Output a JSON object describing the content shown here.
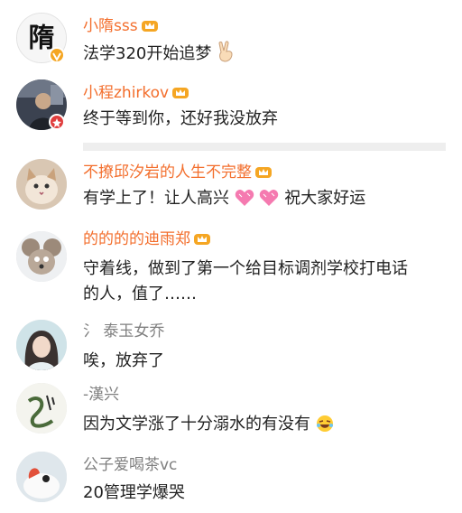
{
  "comments": [
    {
      "username": "小隋sss",
      "text": "法学320开始追梦",
      "text_icon": "victory-hand-icon",
      "name_style": "orange",
      "avatar_glyph": "隋"
    },
    {
      "username": "小程zhirkov",
      "text": "终于等到你，还好我没放弃",
      "name_style": "orange"
    },
    {
      "username": "不撩邱汐岩的人生不完整",
      "text_part1": "有学上了！让人高兴",
      "text_part2": "祝大家好运",
      "name_style": "orange"
    },
    {
      "username": "的的的的迪雨郑",
      "text": "守着线，做到了第一个给目标调剂学校打电话的人，值了……",
      "name_style": "orange"
    },
    {
      "username": "氵 泰玉女乔",
      "text": "唉，放弃了",
      "name_style": "gray"
    },
    {
      "username": "-漢兴",
      "text": "因为文学涨了十分溺水的有没有",
      "name_style": "gray"
    },
    {
      "username": "公子爱喝茶vc",
      "text": "20管理学爆哭",
      "name_style": "gray"
    }
  ],
  "colors": {
    "vip_name": "#f36e2c",
    "normal_name": "#7f7f7f",
    "text": "#222222",
    "crown": "#f5a623"
  }
}
